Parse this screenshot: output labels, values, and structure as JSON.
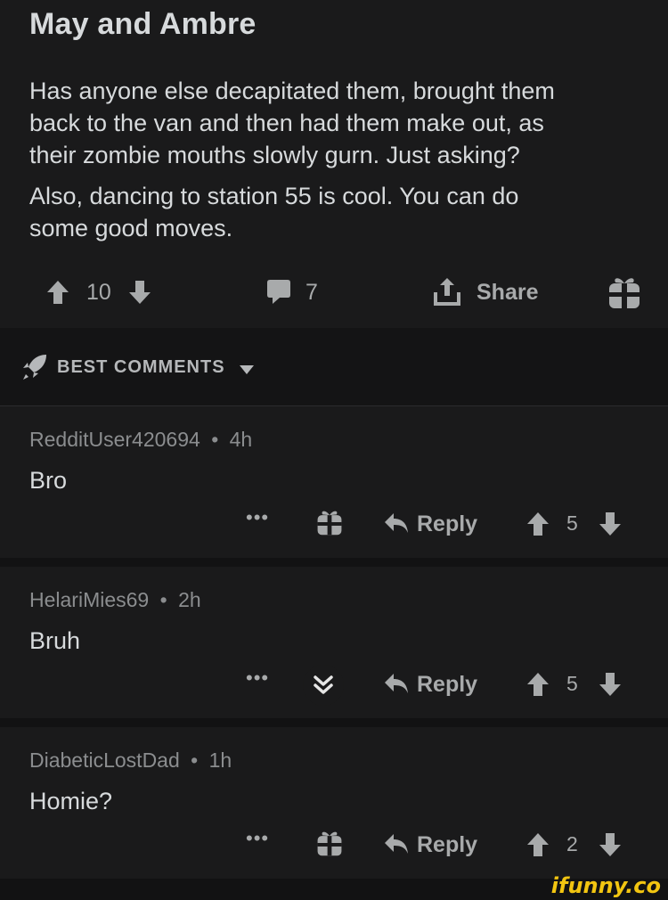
{
  "post": {
    "title": "May and Ambre",
    "body": [
      "Has anyone else decapitated them, brought them\nback to the van and then had them make out, as\ntheir zombie mouths slowly gurn. Just asking?",
      "Also, dancing to station 55 is cool. You can do\nsome good moves."
    ],
    "score": "10",
    "comment_count": "7",
    "share_label": "Share"
  },
  "sort": {
    "label": "BEST COMMENTS"
  },
  "comments": [
    {
      "author": "RedditUser420694",
      "age": "4h",
      "text": "Bro",
      "score": "5",
      "reply_label": "Reply"
    },
    {
      "author": "HelariMies69",
      "age": "2h",
      "text": "Bruh",
      "score": "5",
      "reply_label": "Reply"
    },
    {
      "author": "DiabeticLostDad",
      "age": "1h",
      "text": "Homie?",
      "score": "2",
      "reply_label": "Reply"
    }
  ],
  "more_label": "•••",
  "meta_separator": "•",
  "watermark": "ifunny.co",
  "colors": {
    "background": "#1a1a1b",
    "text": "#d7dadc",
    "muted": "#a8aaab",
    "watermark": "#f2c511"
  },
  "icons": [
    "arrow-up-icon",
    "arrow-down-icon",
    "comment-bubble-icon",
    "share-icon",
    "gift-icon",
    "rocket-icon",
    "caret-down-icon",
    "reply-arrow-icon",
    "double-chevron-down-icon"
  ]
}
